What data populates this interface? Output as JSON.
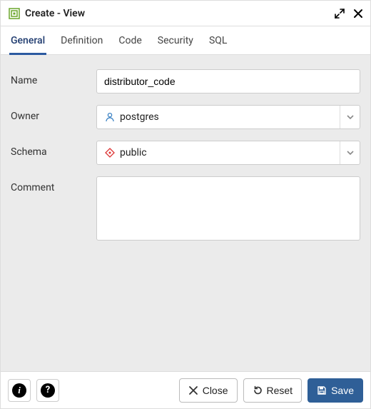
{
  "title": "Create - View",
  "tabs": [
    "General",
    "Definition",
    "Code",
    "Security",
    "SQL"
  ],
  "activeTab": 0,
  "fields": {
    "nameLabel": "Name",
    "nameValue": "distributor_code",
    "ownerLabel": "Owner",
    "ownerValue": "postgres",
    "schemaLabel": "Schema",
    "schemaValue": "public",
    "commentLabel": "Comment",
    "commentValue": ""
  },
  "icons": {
    "info": "i",
    "help": "?"
  },
  "footer": {
    "close": "Close",
    "reset": "Reset",
    "save": "Save"
  }
}
